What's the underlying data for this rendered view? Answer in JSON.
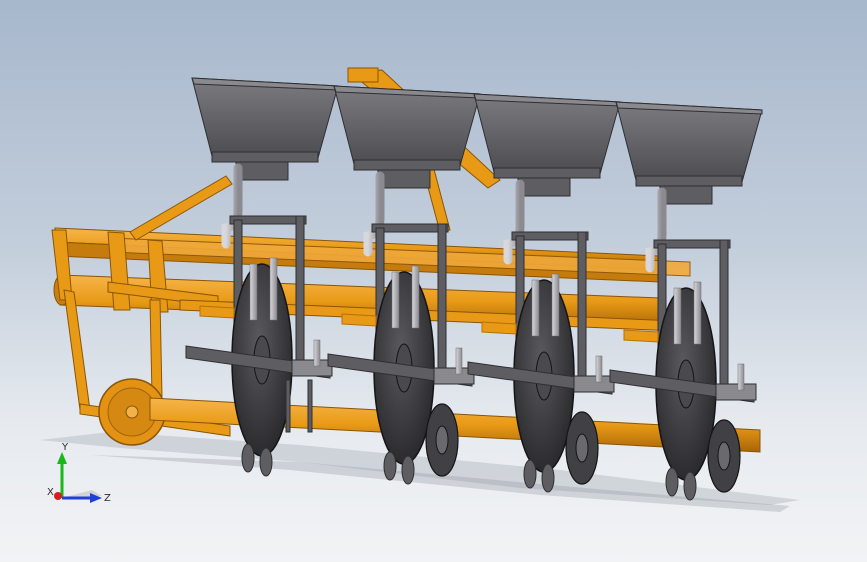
{
  "colors": {
    "frame": "#e89a16",
    "frame_dark": "#b86f0a",
    "metal": "#5e5e62",
    "metal_dark": "#2f2f33",
    "disc": "#3a3a3e",
    "hopper": "#6c6c70",
    "hopper_top": "#8a8a8e",
    "pipe": "#b9b9be",
    "shadow": "#9aa0a8",
    "axis_x": "#d81f1f",
    "axis_y": "#18b818",
    "axis_z": "#1f3fd8"
  },
  "triad": {
    "x_label": "X",
    "y_label": "Y",
    "z_label": "Z"
  }
}
